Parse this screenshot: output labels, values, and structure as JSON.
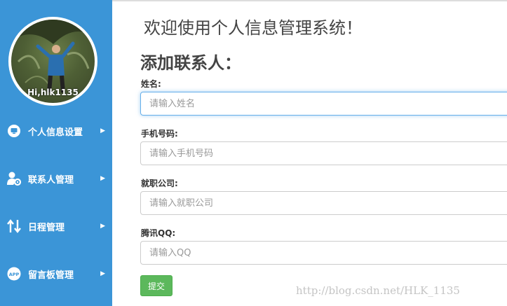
{
  "sidebar": {
    "greeting": "Hi,hlk1135",
    "items": [
      {
        "label": "个人信息设置",
        "icon": "monitor-icon"
      },
      {
        "label": "联系人管理",
        "icon": "user-gear-icon"
      },
      {
        "label": "日程管理",
        "icon": "swap-arrows-icon"
      },
      {
        "label": "留言板管理",
        "icon": "app-icon"
      }
    ],
    "arrow": "▶"
  },
  "main": {
    "title": "欢迎使用个人信息管理系统！",
    "section_title": "添加联系人：",
    "fields": [
      {
        "label": "姓名:",
        "placeholder": "请输入姓名"
      },
      {
        "label": "手机号码:",
        "placeholder": "请输入手机号码"
      },
      {
        "label": "就职公司:",
        "placeholder": "请输入就职公司"
      },
      {
        "label": "腾讯QQ:",
        "placeholder": "请输入QQ"
      }
    ],
    "submit_label": "提交"
  },
  "watermark": "http://blog.csdn.net/HLK_1135",
  "colors": {
    "sidebar": "#3b95d7",
    "submit": "#5cb85c",
    "focus": "#66afe9"
  }
}
